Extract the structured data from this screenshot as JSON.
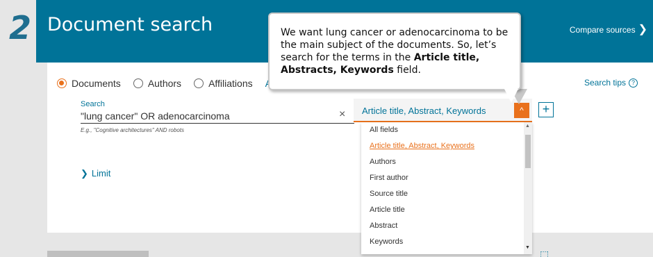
{
  "step": {
    "number": "2"
  },
  "header": {
    "title": "Document search",
    "compare_label": "Compare sources",
    "compare_chevron": "❯"
  },
  "search_type": {
    "options": [
      {
        "label": "Documents",
        "checked": true
      },
      {
        "label": "Authors",
        "checked": false
      },
      {
        "label": "Affiliations",
        "checked": false
      }
    ],
    "partial_option": "A"
  },
  "search_tips": {
    "label": "Search tips",
    "icon": "?"
  },
  "search": {
    "label": "Search",
    "value": "\"lung cancer\" OR adenocarcinoma",
    "example": "E.g., \"Cognitive architectures\" AND robots",
    "clear_icon": "×"
  },
  "limit": {
    "chevron": "❯",
    "label": "Limit"
  },
  "field_select": {
    "value": "Article title, Abstract, Keywords",
    "toggle_icon": "^",
    "options": [
      "All fields",
      "Article title, Abstract, Keywords",
      "Authors",
      "First author",
      "Source title",
      "Article title",
      "Abstract",
      "Keywords"
    ],
    "selected_index": 1
  },
  "add_field": {
    "icon": "+"
  },
  "callout": {
    "text_before": "We want lung cancer or adenocarcinoma to be the main subject of the documents. So, let’s search for the terms in the ",
    "text_bold": "Article title, Abstracts, Keywords",
    "text_after": " field."
  },
  "colors": {
    "header": "#007398",
    "accent": "#e9711c",
    "step": "#1f6e8f"
  }
}
